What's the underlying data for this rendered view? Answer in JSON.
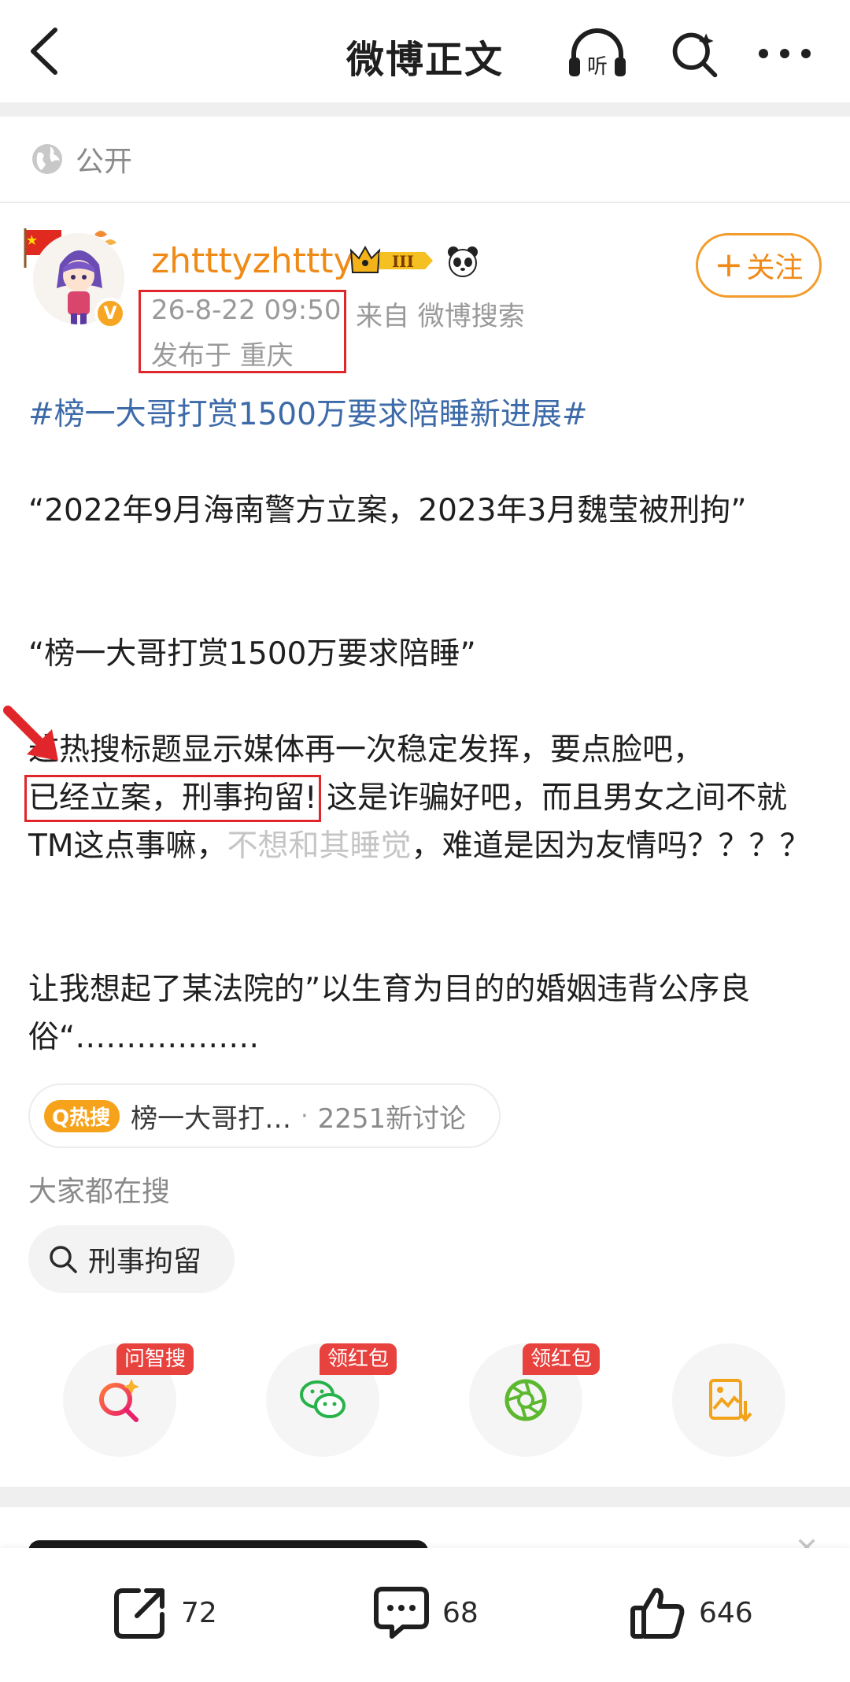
{
  "header": {
    "title": "微博正文",
    "listen_icon": "listen-headphones-icon",
    "search_icon": "search-sparkle-icon",
    "more_icon": "more-dots-icon"
  },
  "visibility": {
    "label": "公开",
    "icon": "globe-icon"
  },
  "author": {
    "username": "zhtttyzhttty",
    "level_badge": "III",
    "verified_badge": "V",
    "follow_label": "关注",
    "post_time": "26-8-22 09:50",
    "source": "来自 微博搜索",
    "location": "发布于 重庆"
  },
  "post": {
    "hashtag": "#榜一大哥打赏1500万要求陪睡新进展#",
    "para1": "“2022年9月海南警方立案，2023年3月魏莹被刑拘”",
    "para2": "“榜一大哥打赏1500万要求陪睡”",
    "para3_a": "这热搜标题显示媒体再一次稳定发挥，要点脸吧，",
    "para3_highlight": "已经立案，刑事拘留!",
    "para3_b": " 这是诈骗好吧，而且男女之间不就TM这点事嘛，",
    "para3_watermark": "不想和其睡觉",
    "para3_c": "，难道是因为友情吗？？？？",
    "para4": "让我想起了某法院的”以生育为目的的婚姻违背公序良俗“………………"
  },
  "topic": {
    "hot_label": "Q热搜",
    "text": "榜一大哥打…",
    "separator": "·",
    "count": "2251新讨论"
  },
  "search": {
    "label": "大家都在搜",
    "term": "刑事拘留"
  },
  "actions": [
    {
      "badge": "问智搜",
      "icon": "ai-search-icon"
    },
    {
      "badge": "领红包",
      "icon": "wechat-icon"
    },
    {
      "badge": "领红包",
      "icon": "moments-icon"
    },
    {
      "badge": "",
      "icon": "save-image-icon"
    }
  ],
  "bottom_bar": {
    "share_count": "72",
    "comment_count": "68",
    "like_count": "646"
  },
  "colors": {
    "brand_orange": "#f08a16",
    "hashtag_blue": "#3d6aa8",
    "highlight_red": "#e0262a",
    "badge_red": "#e8423f"
  }
}
